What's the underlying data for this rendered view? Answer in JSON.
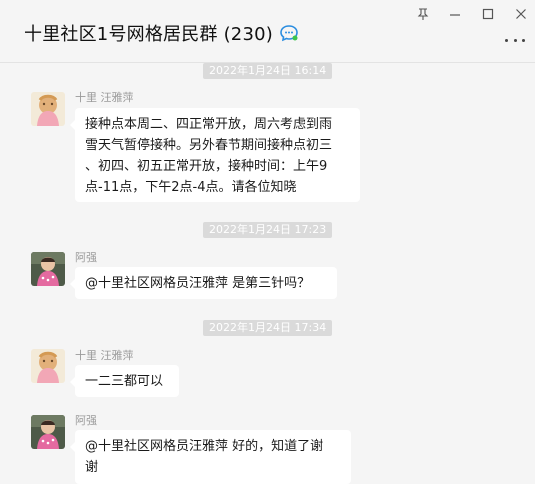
{
  "header": {
    "title": "十里社区1号网格居民群 (230)"
  },
  "messages": [
    {
      "time": "2022年1月24日 16:14",
      "sender": "十里 汪雅萍",
      "text_lines": [
        "接种点本周二、四正常开放，周六考虑到雨",
        "雪天气暂停接种。另外春节期间接种点初三",
        "、初四、初五正常开放，接种时间：上午9",
        "点-11点，下午2点-4点。请各位知晓"
      ]
    },
    {
      "time": "2022年1月24日 17:23",
      "sender": "阿强",
      "text_lines": [
        "@十里社区网格员汪雅萍 是第三针吗？"
      ]
    },
    {
      "time": "2022年1月24日 17:34",
      "sender": "十里 汪雅萍",
      "text_lines": [
        "一二三都可以"
      ]
    },
    {
      "sender": "阿强",
      "text_lines": [
        "@十里社区网格员汪雅萍 好的，知道了谢",
        "谢"
      ]
    }
  ]
}
